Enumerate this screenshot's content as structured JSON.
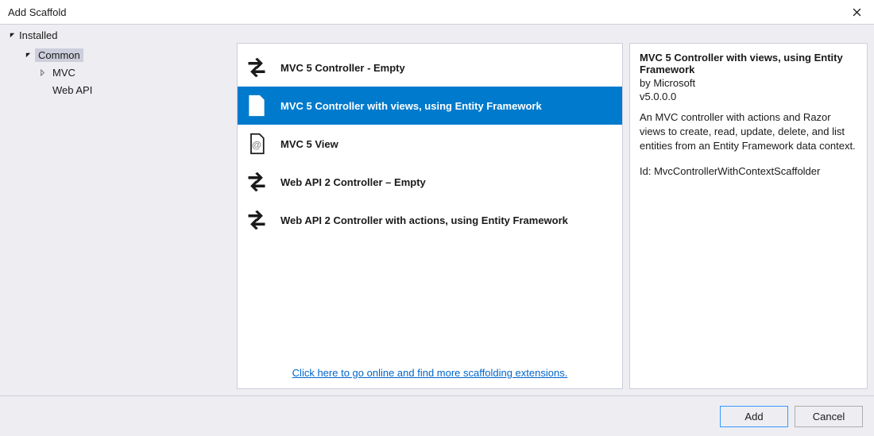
{
  "window": {
    "title": "Add Scaffold"
  },
  "tree": {
    "root_label": "Installed",
    "nodes": {
      "common": {
        "label": "Common"
      },
      "mvc": {
        "label": "MVC"
      },
      "webapi": {
        "label": "Web API"
      }
    }
  },
  "list": {
    "items": [
      {
        "label": "MVC 5 Controller - Empty",
        "icon": "arrows"
      },
      {
        "label": "MVC 5 Controller with views, using Entity Framework",
        "icon": "doc-arrows"
      },
      {
        "label": "MVC 5 View",
        "icon": "doc-at"
      },
      {
        "label": "Web API 2 Controller – Empty",
        "icon": "arrows"
      },
      {
        "label": "Web API 2 Controller with actions, using Entity Framework",
        "icon": "arrows"
      }
    ],
    "selected_index": 1,
    "online_link_text": "Click here to go online and find more scaffolding extensions."
  },
  "details": {
    "title": "MVC 5 Controller with views, using Entity Framework",
    "by": "by Microsoft",
    "version": "v5.0.0.0",
    "description": "An MVC controller with actions and Razor views to create, read, update, delete, and list entities from an Entity Framework data context.",
    "id_line": "Id: MvcControllerWithContextScaffolder"
  },
  "footer": {
    "add_label": "Add",
    "cancel_label": "Cancel"
  }
}
